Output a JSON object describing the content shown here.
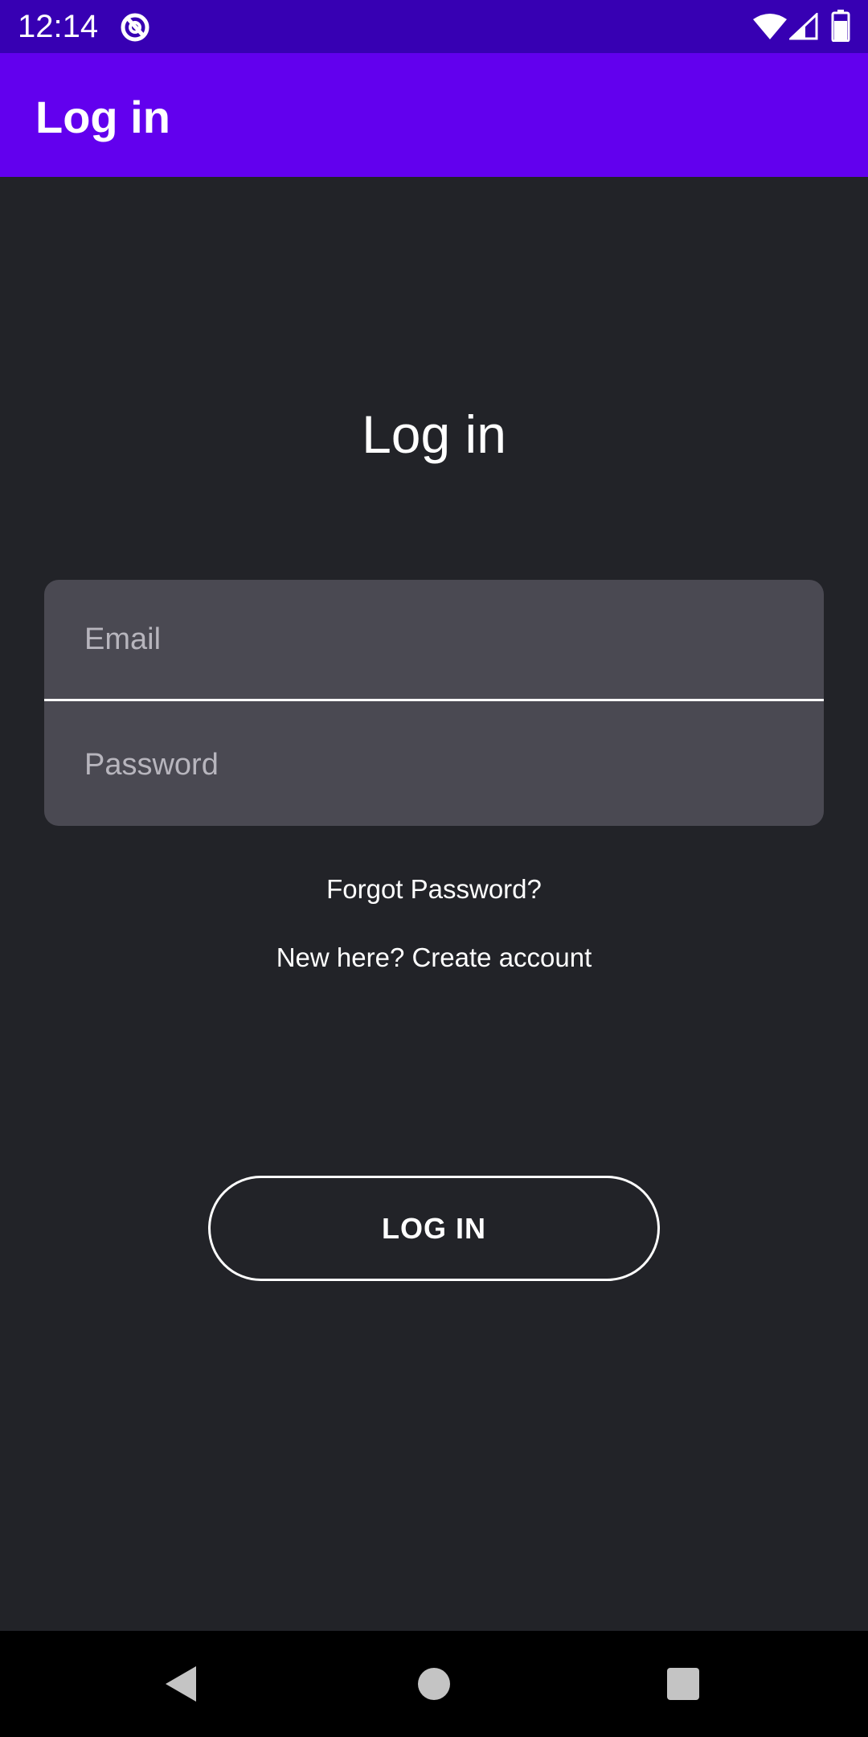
{
  "status_bar": {
    "time": "12:14",
    "icons": [
      "notification-icon",
      "wifi-icon",
      "signal-icon",
      "battery-icon"
    ]
  },
  "app_bar": {
    "title": "Log in"
  },
  "main": {
    "heading": "Log in",
    "email": {
      "value": "",
      "placeholder": "Email"
    },
    "password": {
      "value": "",
      "placeholder": "Password"
    },
    "forgot_password": "Forgot Password?",
    "create_account": "New here? Create account",
    "login_button": "LOG IN"
  },
  "nav_bar": {
    "icons": [
      "back-icon",
      "home-icon",
      "recents-icon"
    ]
  },
  "colors": {
    "status_bar": "#3700b3",
    "app_bar": "#6200ee",
    "background": "#222328",
    "field_background": "#4a4952",
    "text": "#ffffff",
    "placeholder": "#b7b5bd"
  }
}
